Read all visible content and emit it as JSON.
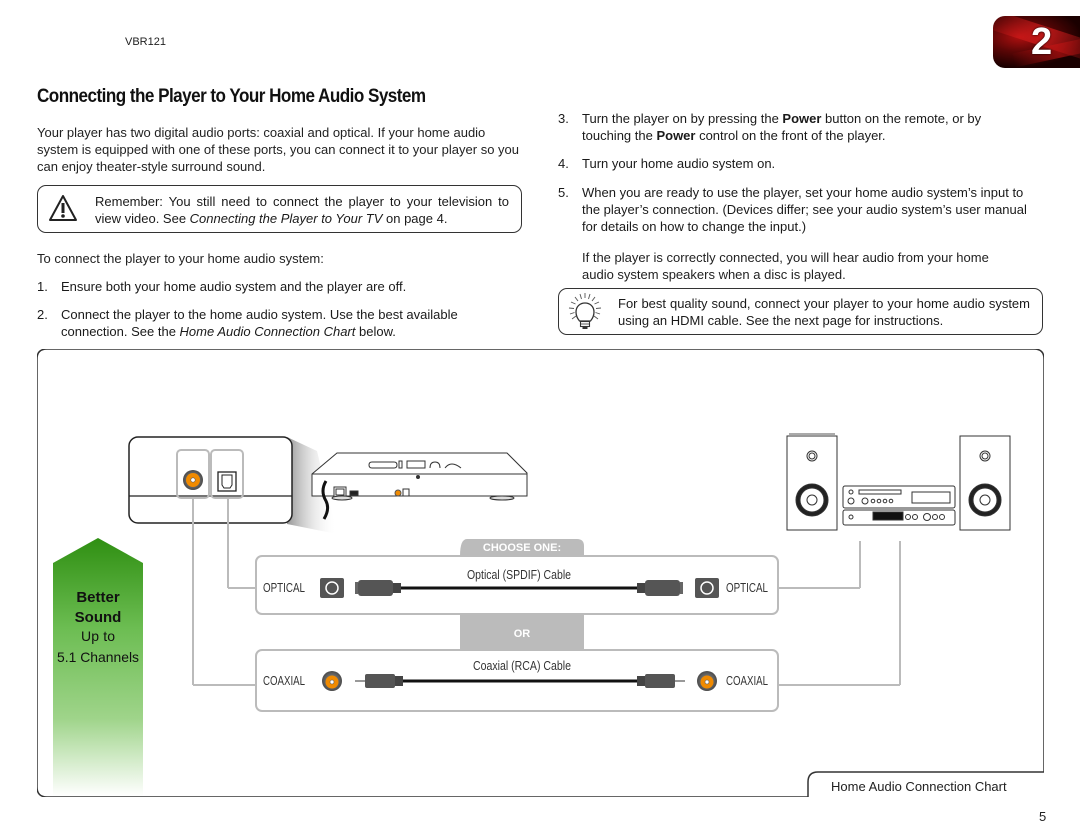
{
  "header": {
    "model": "VBR121",
    "chapter_number": "2"
  },
  "page_title": "Connecting the Player to Your Home Audio System",
  "intro": "Your player has two digital audio ports: coaxial and optical. If your home audio system is equipped with one of these ports, you can connect it to your player so you can enjoy theater-style surround sound.",
  "warning": {
    "icon": "warning-triangle-icon",
    "text_before": "Remember: You still need to connect the player to your television to view video. See ",
    "link_text": "Connecting the Player to Your TV",
    "text_after": " on page 4."
  },
  "list_intro": "To connect the player to your home audio system:",
  "steps": [
    {
      "num": "1.",
      "text": "Ensure both your home audio system and the player are off."
    },
    {
      "num": "2.",
      "text_before": "Connect the player to the home audio system. Use the best available connection. See the ",
      "ref": "Home Audio Connection Chart",
      "text_after": " below."
    },
    {
      "num": "3.",
      "text_a": "Turn the player on by pressing the ",
      "bold_a": "Power",
      "text_b": " button on the remote, or by touching the ",
      "bold_b": "Power",
      "text_c": " control on the front of the player."
    },
    {
      "num": "4.",
      "text": "Turn your home audio system on."
    },
    {
      "num": "5.",
      "text": "When you are ready to use the player, set your home audio system’s input to the player’s connection. (Devices differ; see your audio system’s user manual for details on how to change the input.)"
    }
  ],
  "result_text": "If the player is correctly connected, you will hear audio from your home audio system speakers when a disc is played.",
  "tip": {
    "icon": "lightbulb-icon",
    "text": "For best quality sound, connect your player to your home audio system using an HDMI cable. See the next page for instructions."
  },
  "chart": {
    "caption": "Home Audio Connection Chart",
    "quality_arrow": {
      "line1": "Better",
      "line2": "Sound",
      "line3": "Up to",
      "line4": "5.1 Channels",
      "color": "#3a9a1e"
    },
    "choose_label": "CHOOSE ONE:",
    "or_label": "OR",
    "options": [
      {
        "port_left": "OPTICAL",
        "cable": "Optical (SPDIF) Cable",
        "port_right": "OPTICAL"
      },
      {
        "port_left": "COAXIAL",
        "cable": "Coaxial (RCA) Cable",
        "port_right": "COAXIAL"
      }
    ],
    "accent_orange": "#f08a00"
  },
  "page_number": "5"
}
